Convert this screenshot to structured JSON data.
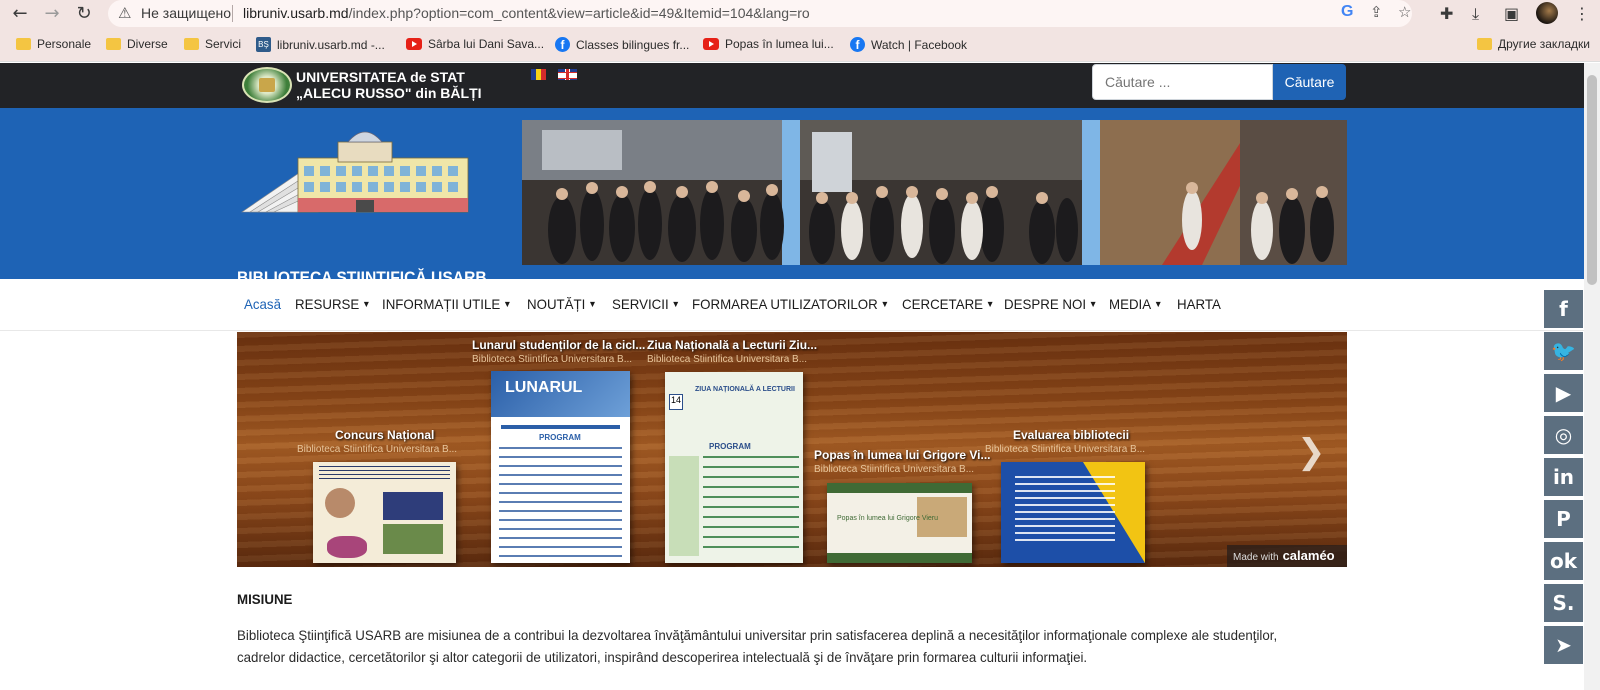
{
  "browser": {
    "security_label": "Не защищено",
    "url_host": "libruniv.usarb.md",
    "url_path": "/index.php?option=com_content&view=article&id=49&Itemid=104&lang=ro",
    "bookmarks": [
      {
        "label": "Personale",
        "icon": "folder-icon"
      },
      {
        "label": "Diverse",
        "icon": "folder-icon"
      },
      {
        "label": "Servici",
        "icon": "folder-icon"
      },
      {
        "label": "libruniv.usarb.md -...",
        "icon": "site-icon"
      },
      {
        "label": "Sârba lui Dani Sava...",
        "icon": "youtube-icon"
      },
      {
        "label": "Classes bilingues fr...",
        "icon": "facebook-icon"
      },
      {
        "label": "Popas în lumea lui...",
        "icon": "youtube-icon"
      },
      {
        "label": "Watch | Facebook",
        "icon": "facebook-icon"
      }
    ],
    "other_bookmarks": "Другие закладки"
  },
  "header": {
    "university_name": "UNIVERSITATEA de STAT\n„ALECU RUSSO\" din BĂLȚI",
    "search_placeholder": "Căutare ...",
    "search_button": "Căutare",
    "library_title": "BIBLIOTECA ŞTIINŢIFICĂ USARB"
  },
  "nav": [
    {
      "label": "Acasă",
      "active": true,
      "dropdown": false
    },
    {
      "label": "RESURSE",
      "dropdown": true
    },
    {
      "label": "INFORMAȚII UTILE",
      "dropdown": true
    },
    {
      "label": "NOUTĂȚI",
      "dropdown": true
    },
    {
      "label": "SERVICII",
      "dropdown": true
    },
    {
      "label": "FORMAREA UTILIZATORILOR",
      "dropdown": true
    },
    {
      "label": "CERCETARE",
      "dropdown": true
    },
    {
      "label": "DESPRE NOI",
      "dropdown": true
    },
    {
      "label": "MEDIA",
      "dropdown": true
    },
    {
      "label": "HARTA",
      "dropdown": false
    }
  ],
  "publications": [
    {
      "title": "Lunarul studenților de la cicl...",
      "publisher": "Biblioteca Stiintifica Universitara B..."
    },
    {
      "title": "Ziua Națională a Lecturii Ziu...",
      "publisher": "Biblioteca Stiintifica Universitara B..."
    },
    {
      "title": "Concurs Național",
      "publisher": "Biblioteca Stiintifica Universitara B..."
    },
    {
      "title": "Popas în lumea lui Grigore Vi...",
      "publisher": "Biblioteca Stiintifica Universitara B..."
    },
    {
      "title": "Evaluarea bibliotecii",
      "publisher": "Biblioteca Stiintifica Universitara B..."
    }
  ],
  "calameo": {
    "made_with": "Made with",
    "brand": "calaméo"
  },
  "content": {
    "heading": "MISIUNE",
    "text": "Biblioteca Ştiinţifică USARB are misiunea de a contribui la dezvoltarea învăţământului universitar prin satisfacerea deplină a necesităţilor informaţionale complexe ale studenţilor, cadrelor didactice, cercetătorilor şi altor categorii de utilizatori, inspirând descoperirea intelectuală şi de învăţare prin formarea culturii informaţiei."
  },
  "social": [
    "facebook-icon",
    "twitter-icon",
    "youtube-icon",
    "instagram-icon",
    "linkedin-icon",
    "pinterest-icon",
    "odnoklassniki-icon",
    "skype-icon",
    "telegram-icon"
  ],
  "social_glyphs": [
    "f",
    "🐦",
    "▶",
    "◎",
    "in",
    "P",
    "ok",
    "S.",
    "➤"
  ],
  "colors": {
    "brand_blue": "#1e63b5",
    "dark_bar": "#222326",
    "social_bg": "#5c6f80"
  }
}
